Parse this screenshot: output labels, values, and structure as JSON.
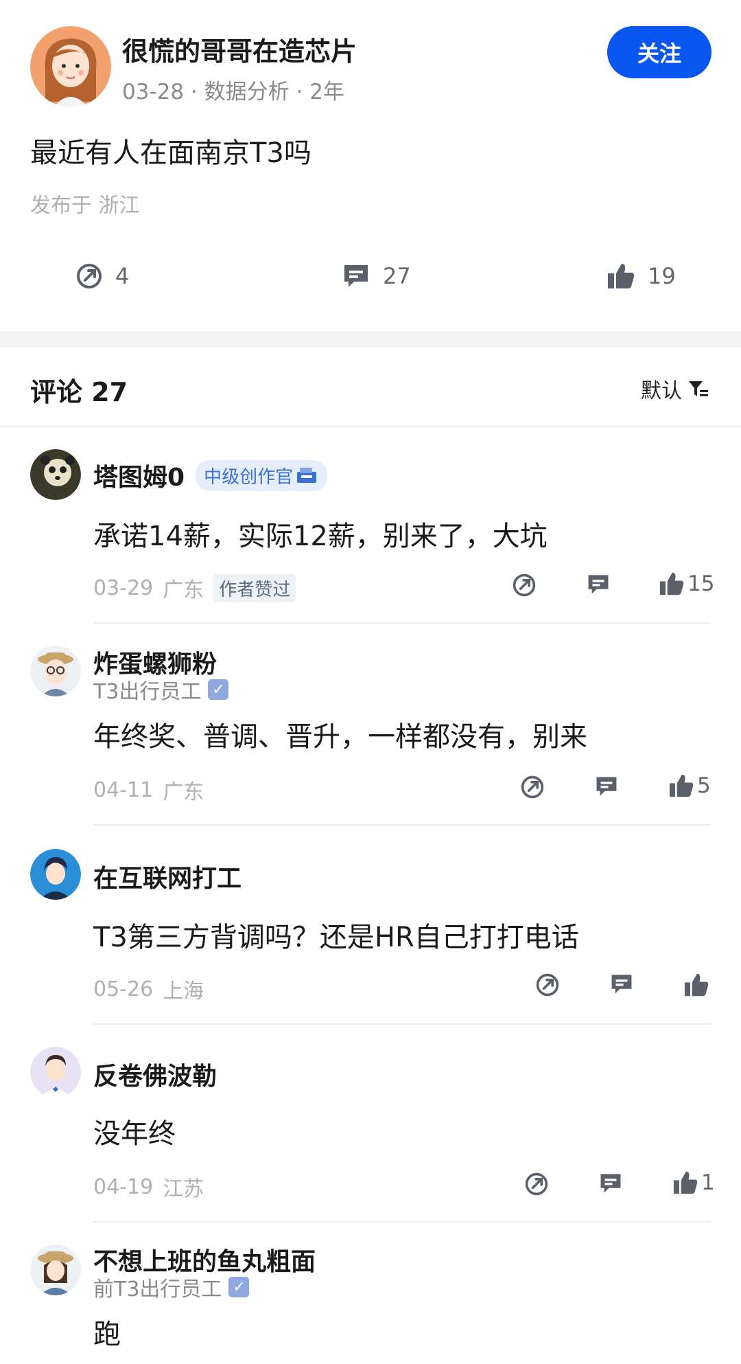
{
  "post": {
    "author": "很慌的哥哥在造芯片",
    "meta": "03-28 · 数据分析 · 2年",
    "follow_label": "关注",
    "title": "最近有人在面南京T3吗",
    "location": "发布于  浙江",
    "actions": {
      "share_count": "4",
      "comment_count": "27",
      "like_count": "19"
    }
  },
  "comments_header": {
    "title": "评论 27",
    "sort_label": "默认"
  },
  "comments": [
    {
      "name": "塔图姆0",
      "level_badge": "中级创作官",
      "text": "承诺14薪，实际12薪，别来了，大坑",
      "date": "03-29",
      "region": "广东",
      "tag": "作者赞过",
      "likes": "15"
    },
    {
      "name": "炸蛋螺狮粉",
      "sub": "T3出行员工",
      "text": "年终奖、普调、晋升，一样都没有，别来",
      "date": "04-11",
      "region": "广东",
      "likes": "5"
    },
    {
      "name": "在互联网打工",
      "text": "T3第三方背调吗？还是HR自己打打电话",
      "date": "05-26",
      "region": "上海",
      "likes": ""
    },
    {
      "name": "反卷佛波勒",
      "text": "没年终",
      "date": "04-19",
      "region": "江苏",
      "likes": "1"
    },
    {
      "name": "不想上班的鱼丸粗面",
      "sub": "前T3出行员工",
      "text": "跑"
    }
  ],
  "colors": {
    "accent": "#0a56f0",
    "icon": "#5a5f69"
  }
}
